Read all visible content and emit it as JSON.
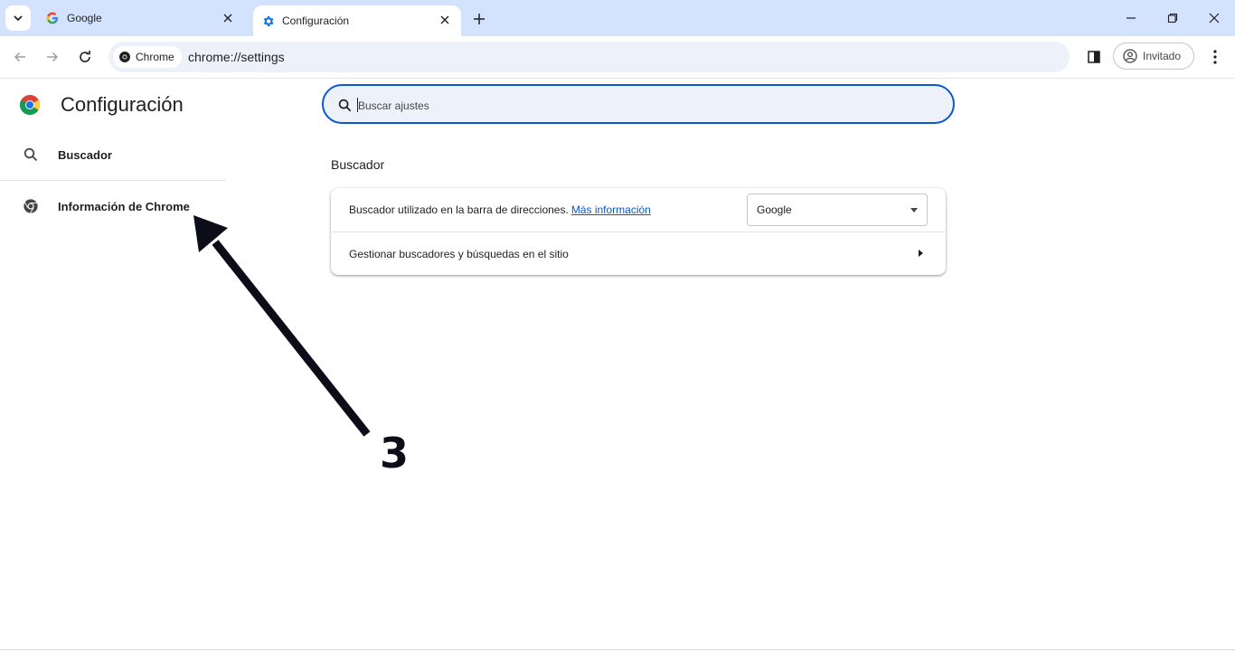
{
  "tabs": [
    {
      "title": "Google",
      "favicon": "google-g-icon"
    },
    {
      "title": "Configuración",
      "favicon": "gear-icon",
      "active": true
    }
  ],
  "toolbar": {
    "chip_label": "Chrome",
    "url": "chrome://settings",
    "profile_label": "Invitado"
  },
  "settings": {
    "title": "Configuración",
    "search_placeholder": "Buscar ajustes",
    "nav": [
      {
        "label": "Buscador",
        "icon": "search-icon"
      },
      {
        "label": "Información de Chrome",
        "icon": "chrome-icon"
      }
    ],
    "section_title": "Buscador",
    "row1_label": "Buscador utilizado en la barra de direcciones.",
    "row1_link": "Más información",
    "search_engine": "Google",
    "row2_label": "Gestionar buscadores y búsquedas en el sitio"
  },
  "annotation": {
    "number": "3",
    "color": "#0d0d1a"
  },
  "colors": {
    "accent": "#0b57d0",
    "tabstrip": "#d3e3fd",
    "omnibox": "#edf2fa"
  }
}
